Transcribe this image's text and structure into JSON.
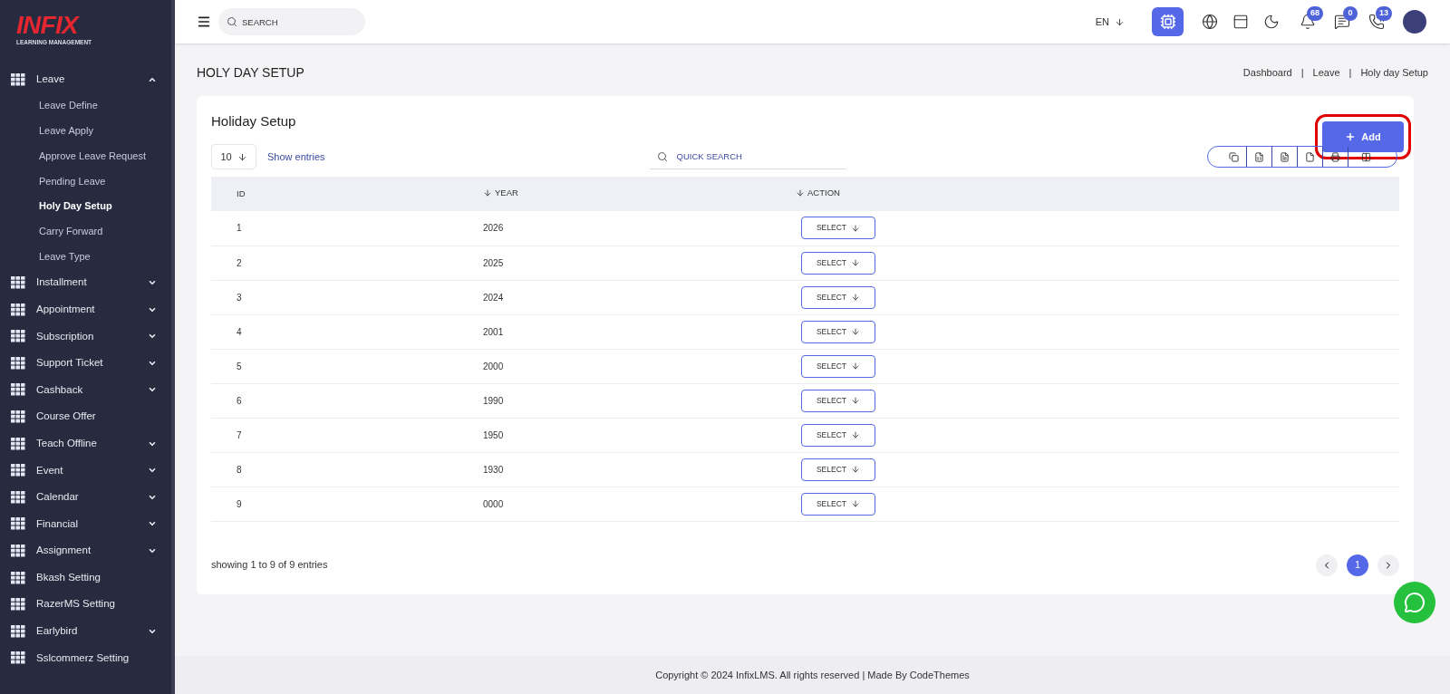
{
  "logo": {
    "brand": "INFIX",
    "tagline": "LEARNING MANAGEMENT"
  },
  "sidebar": {
    "items": [
      {
        "label": "Leave",
        "kind": "menu",
        "expanded": true,
        "children": [
          {
            "label": "Leave Define",
            "selected": false
          },
          {
            "label": "Leave Apply",
            "selected": false
          },
          {
            "label": "Approve Leave Request",
            "selected": false
          },
          {
            "label": "Pending Leave",
            "selected": false
          },
          {
            "label": "Holy Day Setup",
            "selected": true
          },
          {
            "label": "Carry Forward",
            "selected": false
          },
          {
            "label": "Leave Type",
            "selected": false
          }
        ]
      },
      {
        "label": "Installment",
        "kind": "menu",
        "expanded": false
      },
      {
        "label": "Appointment",
        "kind": "menu",
        "expanded": false
      },
      {
        "label": "Subscription",
        "kind": "menu",
        "expanded": false
      },
      {
        "label": "Support Ticket",
        "kind": "menu",
        "expanded": false
      },
      {
        "label": "Cashback",
        "kind": "menu",
        "expanded": false
      },
      {
        "label": "Course Offer",
        "kind": "link"
      },
      {
        "label": "Teach Offline",
        "kind": "menu",
        "expanded": false
      },
      {
        "label": "Event",
        "kind": "menu",
        "expanded": false
      },
      {
        "label": "Calendar",
        "kind": "menu",
        "expanded": false
      },
      {
        "label": "Financial",
        "kind": "menu",
        "expanded": false
      },
      {
        "label": "Assignment",
        "kind": "menu",
        "expanded": false
      },
      {
        "label": "Bkash Setting",
        "kind": "link"
      },
      {
        "label": "RazerMS Setting",
        "kind": "link"
      },
      {
        "label": "Earlybird",
        "kind": "menu",
        "expanded": false
      },
      {
        "label": "Sslcommerz Setting",
        "kind": "link"
      }
    ]
  },
  "header": {
    "search_placeholder": "SEARCH",
    "language": "EN",
    "notifications": "68",
    "messages": "0",
    "calls": "13"
  },
  "page": {
    "title": "HOLY DAY SETUP",
    "breadcrumbs": [
      "Dashboard",
      "Leave",
      "Holy day Setup"
    ],
    "breadcrumb_separator": "|"
  },
  "card": {
    "title": "Holiday Setup",
    "add_button": {
      "label": "Add",
      "highlighted": true
    },
    "page_size": "10",
    "show_entries": "Show entries",
    "search_placeholder": "QUICK SEARCH",
    "columns": [
      {
        "label": "ID",
        "sortable": false
      },
      {
        "label": "YEAR",
        "sortable": true
      },
      {
        "label": "ACTION",
        "sortable": true
      }
    ],
    "rows": [
      {
        "id": "1",
        "year": "2026",
        "action": "SELECT"
      },
      {
        "id": "2",
        "year": "2025",
        "action": "SELECT"
      },
      {
        "id": "3",
        "year": "2024",
        "action": "SELECT"
      },
      {
        "id": "4",
        "year": "2001",
        "action": "SELECT"
      },
      {
        "id": "5",
        "year": "2000",
        "action": "SELECT"
      },
      {
        "id": "6",
        "year": "1990",
        "action": "SELECT"
      },
      {
        "id": "7",
        "year": "1950",
        "action": "SELECT"
      },
      {
        "id": "8",
        "year": "1930",
        "action": "SELECT"
      },
      {
        "id": "9",
        "year": "0000",
        "action": "SELECT"
      }
    ],
    "summary": "showing 1 to 9 of 9 entries",
    "pages": [
      {
        "label": "1",
        "selected": true
      }
    ]
  },
  "footer": "Copyright © 2024 InfixLMS. All rights reserved | Made By CodeThemes"
}
